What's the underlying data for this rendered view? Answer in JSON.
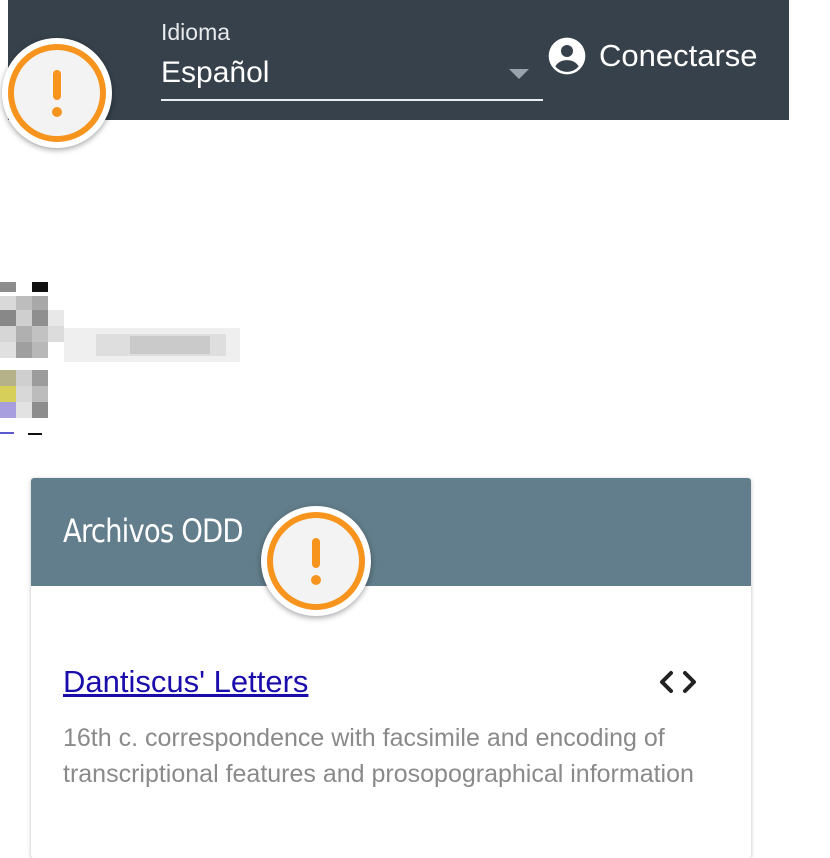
{
  "header": {
    "language_label": "Idioma",
    "language_value": "Español",
    "login_label": "Conectarse",
    "background": "#36414b"
  },
  "card": {
    "title": "Archivos ODD",
    "header_color": "#627d8b",
    "items": [
      {
        "link_text": "Dantiscus' Letters",
        "description": "16th c. correspondence with facsimile and encoding of transcriptional features and prosopographical information"
      }
    ]
  },
  "icons": {
    "warning": "warning-icon",
    "user": "account-circle-icon",
    "code": "code-icon",
    "dropdown": "chevron-down-icon"
  },
  "colors": {
    "warning_orange": "#f7941d",
    "link": "#1a0dab"
  }
}
